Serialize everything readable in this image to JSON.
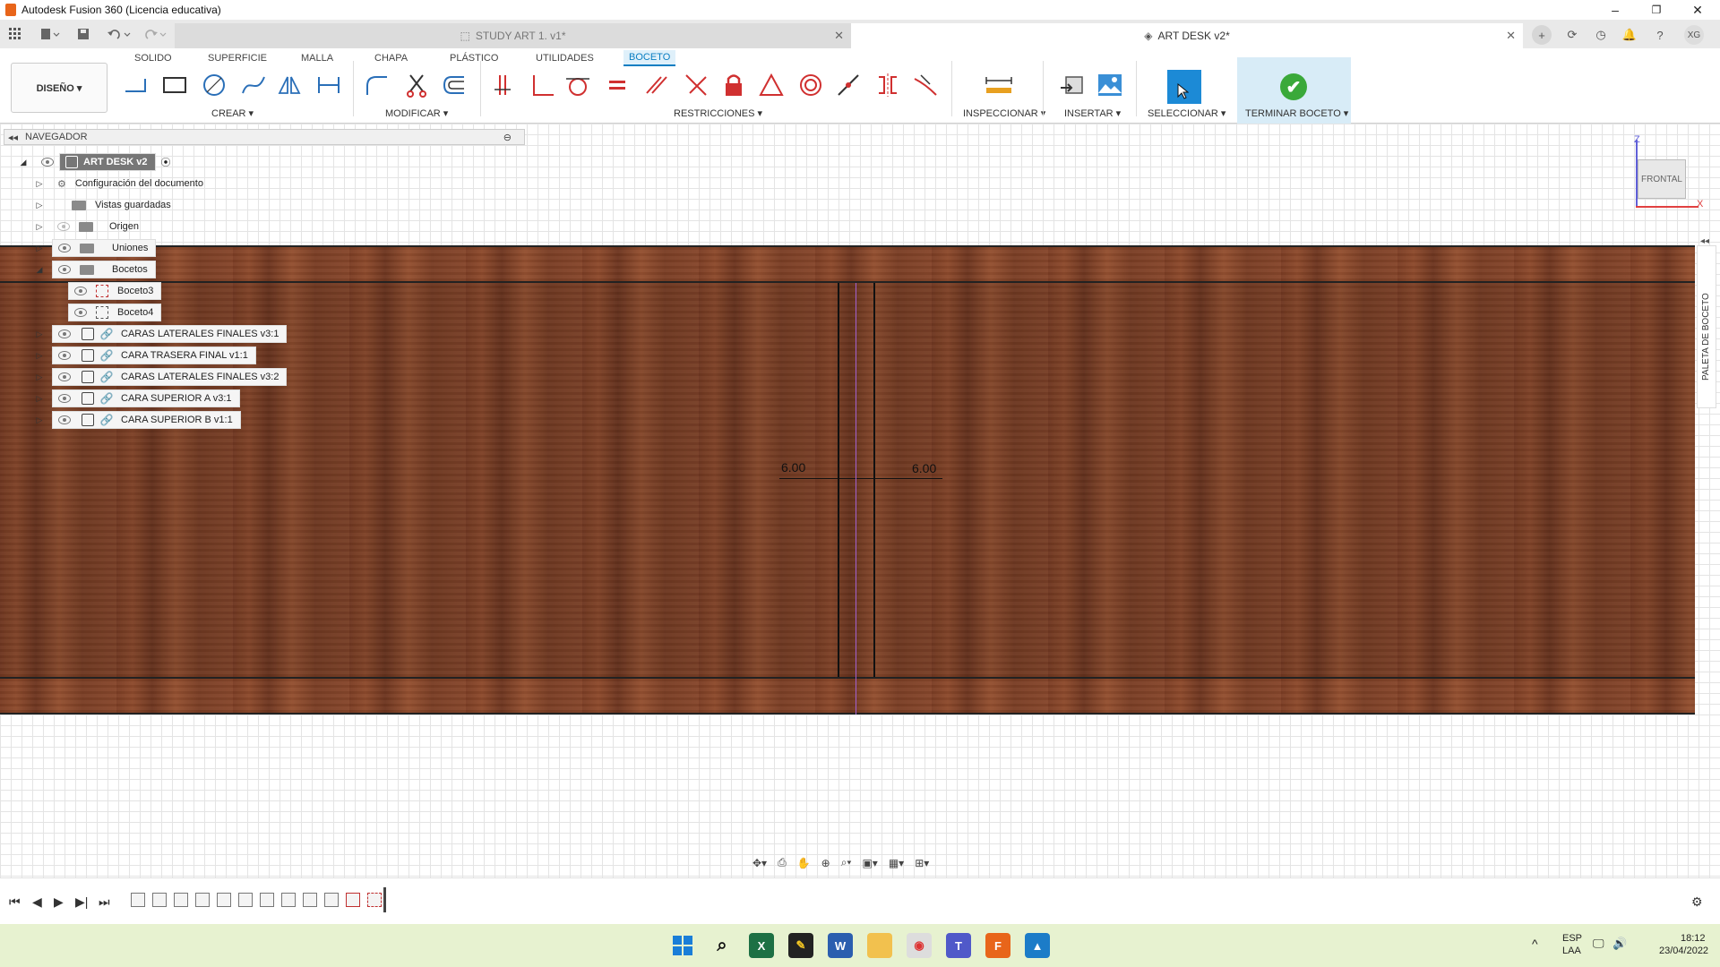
{
  "window": {
    "title": "Autodesk Fusion 360 (Licencia educativa)",
    "controls": {
      "minimize": "–",
      "maximize": "❐",
      "close": "✕"
    }
  },
  "tabs": {
    "inactive": "STUDY ART 1. v1*",
    "active": "ART DESK v2*",
    "close_glyph": "✕",
    "user_initials": "XG"
  },
  "ribbon": {
    "tabs": [
      "SOLIDO",
      "SUPERFICIE",
      "MALLA",
      "CHAPA",
      "PLÁSTICO",
      "UTILIDADES",
      "BOCETO"
    ],
    "active_tab": "BOCETO",
    "workspace": "DISEÑO ▾",
    "groups": {
      "create": "CREAR ▾",
      "modify": "MODIFICAR ▾",
      "constraints": "RESTRICCIONES ▾",
      "inspect": "INSPECCIONAR ▾",
      "insert": "INSERTAR ▾",
      "select": "SELECCIONAR ▾",
      "finish": "TERMINAR BOCETO ▾"
    },
    "finish_glyph": "✔"
  },
  "navigator": {
    "title": "NAVEGADOR",
    "root": "ART DESK v2",
    "items": [
      {
        "label": "Configuración del documento"
      },
      {
        "label": "Vistas guardadas"
      },
      {
        "label": "Origen"
      },
      {
        "label": "Uniones"
      },
      {
        "label": "Bocetos"
      },
      {
        "label": "Boceto3"
      },
      {
        "label": "Boceto4"
      },
      {
        "label": "CARAS LATERALES FINALES v3:1"
      },
      {
        "label": "CARA TRASERA  FINAL v1:1"
      },
      {
        "label": "CARAS LATERALES FINALES v3:2"
      },
      {
        "label": "CARA SUPERIOR A v3:1"
      },
      {
        "label": "CARA SUPERIOR B v1:1"
      }
    ]
  },
  "canvas": {
    "dim_left": "6.00",
    "dim_right": "6.00",
    "viewcube_label": "FRONTAL",
    "axis_z": "Z",
    "axis_x": "X",
    "palette_label": "PALETA DE BOCETO",
    "palette_toggle": "◂◂"
  },
  "colors": {
    "accent": "#0a7ec2",
    "select_blue": "#1c8ad6",
    "finish_green": "#3aa93a",
    "wood": "#7b3d24",
    "taskbar": "#e7f2d0",
    "centerline": "#a060d0"
  },
  "taskbar": {
    "lang_1": "ESP",
    "lang_2": "LAA",
    "time": "18:12",
    "date": "23/04/2022",
    "tray_chevron": "^"
  }
}
